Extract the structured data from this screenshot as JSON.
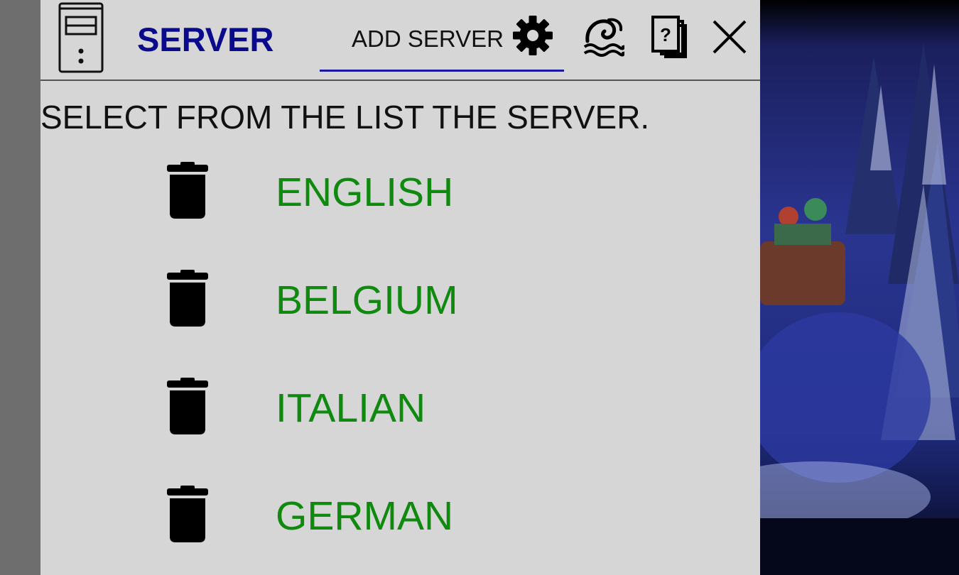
{
  "header": {
    "title": "SERVER",
    "add_server_label": "ADD SERVER",
    "icons": [
      "server-tower-icon",
      "gear-icon",
      "theme-icon",
      "help-icon",
      "close-icon"
    ]
  },
  "instruction": "SELECT FROM THE LIST THE SERVER.",
  "servers": [
    {
      "name": "ENGLISH"
    },
    {
      "name": "BELGIUM"
    },
    {
      "name": "ITALIAN"
    },
    {
      "name": "GERMAN"
    }
  ],
  "colors": {
    "title": "#0a0a8c",
    "server_name": "#0f8a0f",
    "panel_bg": "#d6d6d6",
    "tab_underline": "#1a1aa0"
  }
}
